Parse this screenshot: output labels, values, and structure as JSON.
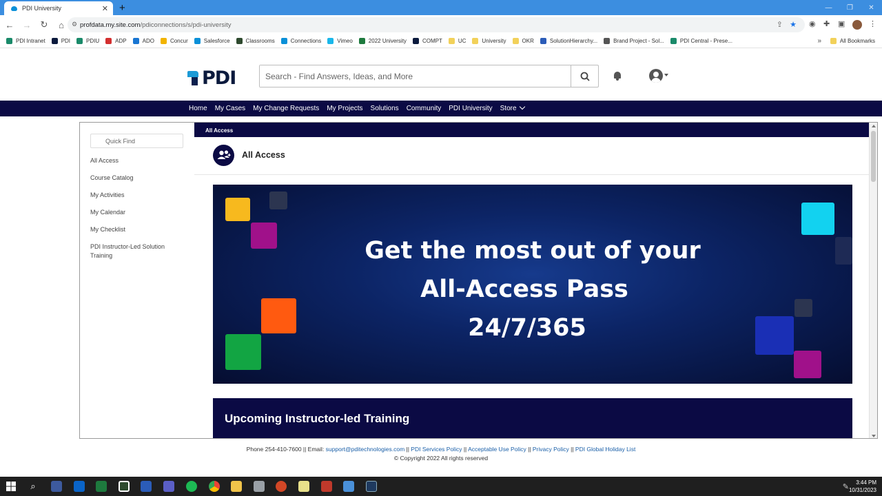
{
  "browser": {
    "tab_title": "PDI University",
    "url_domain": "profdata.my.site.com",
    "url_path": "/pdiconnections/s/pdi-university",
    "bookmarks": [
      {
        "label": "PDI Intranet",
        "color": "#1a8a6a"
      },
      {
        "label": "PDI",
        "color": "#0b1a3d"
      },
      {
        "label": "PDIU",
        "color": "#1a8a6a"
      },
      {
        "label": "ADP",
        "color": "#d32f2f"
      },
      {
        "label": "ADO",
        "color": "#1976d2"
      },
      {
        "label": "Concur",
        "color": "#f2b400"
      },
      {
        "label": "Salesforce",
        "color": "#0a90d8"
      },
      {
        "label": "Classrooms",
        "color": "#2e4a2e"
      },
      {
        "label": "Connections",
        "color": "#0a90d8"
      },
      {
        "label": "Vimeo",
        "color": "#1ab7ea"
      },
      {
        "label": "2022 University",
        "color": "#1e7a3e"
      },
      {
        "label": "COMPT",
        "color": "#0b1a3d"
      },
      {
        "label": "UC",
        "color": "#f2d15a"
      },
      {
        "label": "University",
        "color": "#f2d15a"
      },
      {
        "label": "OKR",
        "color": "#f2d15a"
      },
      {
        "label": "SolutionHierarchy...",
        "color": "#2b5cb8"
      },
      {
        "label": "Brand Project - Sol...",
        "color": "#555555"
      },
      {
        "label": "PDI Central - Prese...",
        "color": "#1a8a6a"
      }
    ],
    "all_bookmarks": "All Bookmarks"
  },
  "header": {
    "logo_text": "PDI",
    "search_placeholder": "Search - Find Answers, Ideas, and More"
  },
  "nav": [
    "Home",
    "My Cases",
    "My Change Requests",
    "My Projects",
    "Solutions",
    "Community",
    "PDI University",
    "Store"
  ],
  "sidebar": {
    "quick_find": "Quick Find",
    "items": [
      "All Access",
      "Course Catalog",
      "My Activities",
      "My Calendar",
      "My Checklist",
      "PDI Instructor-Led Solution Training"
    ]
  },
  "content": {
    "breadcrumb": "All Access",
    "page_title": "All Access",
    "banner_lines": [
      "Get the most out of your",
      "All-Access Pass",
      "24/7/365"
    ],
    "section_title": "Upcoming Instructor-led Training"
  },
  "footer": {
    "phone": "Phone 254-410-7600 || Email: ",
    "email": "support@pditechnologies.com",
    "sep": " || ",
    "links": [
      "PDI Services Policy",
      "Acceptable Use Policy",
      "Privacy Policy",
      "PDI Global Holiday List"
    ],
    "copyright": "© Copyright 2022 All rights reserved"
  },
  "taskbar": {
    "time": "3:44 PM",
    "date": "10/31/2023"
  }
}
